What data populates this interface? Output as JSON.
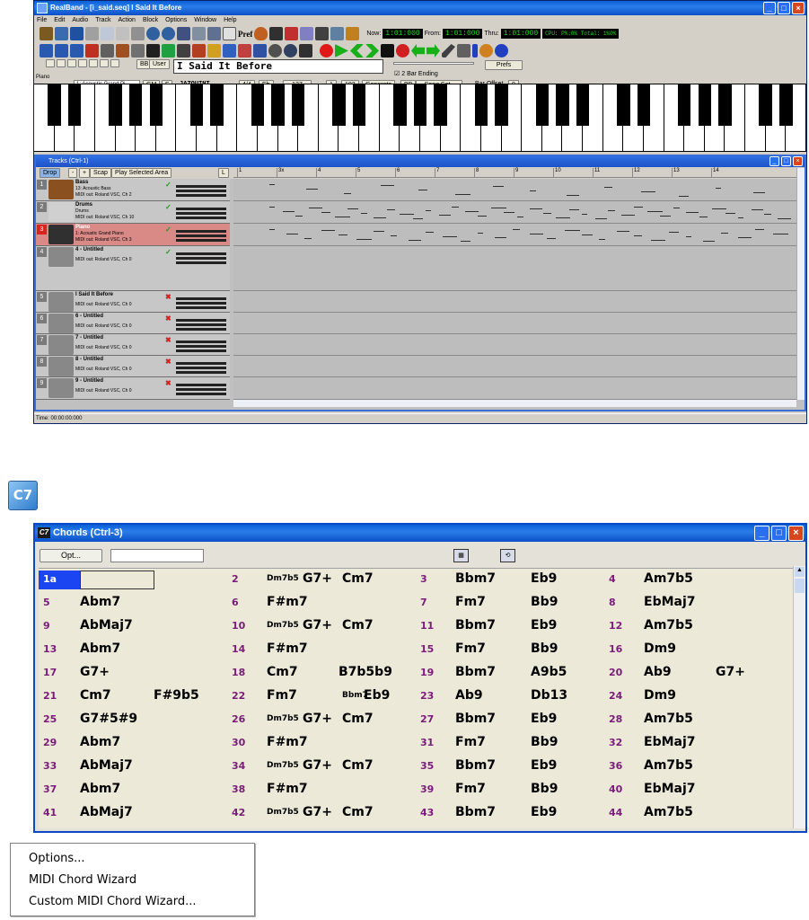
{
  "app": {
    "title": "RealBand - [i_said.seq]   I Said It Before",
    "menu": [
      "File",
      "Edit",
      "Audio",
      "Track",
      "Action",
      "Block",
      "Options",
      "Window",
      "Help"
    ],
    "toolbar_text": {
      "pref": "Pref",
      "now_label": "Now:",
      "now_value": "1:01:000",
      "from_label": "From:",
      "from_value": "1:01:000",
      "thru_label": "Thru:",
      "thru_value": "1:01:000",
      "cpu": "CPU: P%:0% Total: 1%0%"
    },
    "song_title": "I Said It Before",
    "bb_label": "BB",
    "user_label": "User",
    "bar_ending": "2 Bar Ending",
    "prefs_btn": "Prefs",
    "instrument": "1: Acoustic Grand Pi",
    "gm_btn": "GM",
    "f_btn": "F",
    "style": "JAZQUINT",
    "time_sig": "4/4",
    "key": "Eb",
    "tempo": "127",
    "from_bar": "1",
    "to_bar": "103",
    "generate_btn": "Generate",
    "bb_btn": "BB",
    "song_set_btn": "Song Set..",
    "bar_offset_label": "Bar Offset",
    "bar_offset_value": "0",
    "piano_label": "Piano"
  },
  "tracks_window": {
    "title": "Tracks (Ctrl-1)",
    "drop_btn": "Drop",
    "minus_btn": "-",
    "plus_btn": "+",
    "scap_btn": "Scap",
    "play_selected_btn": "Play Selected Area",
    "l_btn": "L",
    "ruler": [
      "1",
      "3x",
      "4",
      "5",
      "6",
      "7",
      "8",
      "9",
      "10",
      "11",
      "12",
      "13",
      "14"
    ],
    "tracks": [
      {
        "num": "1",
        "name": "Bass",
        "sub1": "13: Acoustic Bass",
        "sub2": "MIDI out: Roland VSC, Ch 2",
        "status": "✓",
        "selected": false
      },
      {
        "num": "2",
        "name": "Drums",
        "sub1": "Drums",
        "sub2": "MIDI out: Roland VSC, Ch 10",
        "status": "✓",
        "selected": false
      },
      {
        "num": "3",
        "name": "Piano",
        "sub1": "1: Acoustic Grand Piano",
        "sub2": "MIDI out: Roland VSC, Ch 3",
        "status": "✓",
        "selected": true
      },
      {
        "num": "4",
        "name": "4 - Untitled",
        "sub1": "",
        "sub2": "MIDI out: Roland VSC, Ch 0",
        "status": "✓",
        "selected": false
      },
      {
        "num": "5",
        "name": "I Said It Before",
        "sub1": "",
        "sub2": "MIDI out: Roland VSC, Ch 0",
        "status": "✖",
        "selected": false
      },
      {
        "num": "6",
        "name": "6 - Untitled",
        "sub1": "",
        "sub2": "MIDI out: Roland VSC, Ch 0",
        "status": "✖",
        "selected": false
      },
      {
        "num": "7",
        "name": "7 - Untitled",
        "sub1": "",
        "sub2": "MIDI out: Roland VSC, Ch 0",
        "status": "✖",
        "selected": false
      },
      {
        "num": "8",
        "name": "8 - Untitled",
        "sub1": "",
        "sub2": "MIDI out: Roland VSC, Ch 0",
        "status": "✖",
        "selected": false
      },
      {
        "num": "9",
        "name": "9 - Untitled",
        "sub1": "",
        "sub2": "MIDI out: Roland VSC, Ch 0",
        "status": "✖",
        "selected": false
      }
    ],
    "status_time": "Time: 00:00:00:000"
  },
  "c7_icon_label": "C7",
  "chords_window": {
    "title": "Chords (Ctrl-3)",
    "opt_btn": "Opt...",
    "colors": {
      "bar_number": "#7a1c7a",
      "selected_bar": "#1a45f0",
      "background": "#ece9d8"
    },
    "rows": [
      [
        {
          "n": "1a",
          "c": []
        },
        {
          "n": "2",
          "c": [
            "Dm7b5",
            "G7+",
            "Cm7"
          ]
        },
        {
          "n": "3",
          "c": [
            "Bbm7",
            "Eb9"
          ]
        },
        {
          "n": "4",
          "c": [
            "Am7b5"
          ]
        }
      ],
      [
        {
          "n": "5",
          "c": [
            "Abm7"
          ]
        },
        {
          "n": "6",
          "c": [
            "F#m7"
          ]
        },
        {
          "n": "7",
          "c": [
            "Fm7",
            "Bb9"
          ]
        },
        {
          "n": "8",
          "c": [
            "EbMaj7"
          ]
        }
      ],
      [
        {
          "n": "9",
          "c": [
            "AbMaj7"
          ]
        },
        {
          "n": "10",
          "c": [
            "Dm7b5",
            "G7+",
            "Cm7"
          ]
        },
        {
          "n": "11",
          "c": [
            "Bbm7",
            "Eb9"
          ]
        },
        {
          "n": "12",
          "c": [
            "Am7b5"
          ]
        }
      ],
      [
        {
          "n": "13",
          "c": [
            "Abm7"
          ]
        },
        {
          "n": "14",
          "c": [
            "F#m7"
          ]
        },
        {
          "n": "15",
          "c": [
            "Fm7",
            "Bb9"
          ]
        },
        {
          "n": "16",
          "c": [
            "Dm9"
          ]
        }
      ],
      [
        {
          "n": "17",
          "c": [
            "G7+"
          ]
        },
        {
          "n": "18",
          "c": [
            "Cm7",
            "B7b5b9"
          ]
        },
        {
          "n": "19",
          "c": [
            "Bbm7",
            "A9b5"
          ]
        },
        {
          "n": "20",
          "c": [
            "Ab9",
            "G7+"
          ]
        }
      ],
      [
        {
          "n": "21",
          "c": [
            "Cm7",
            "F#9b5"
          ]
        },
        {
          "n": "22",
          "c": [
            "Fm7",
            "Bbm7",
            "Eb9"
          ]
        },
        {
          "n": "23",
          "c": [
            "Ab9",
            "Db13"
          ]
        },
        {
          "n": "24",
          "c": [
            "Dm9"
          ]
        }
      ],
      [
        {
          "n": "25",
          "c": [
            "G7#5#9"
          ]
        },
        {
          "n": "26",
          "c": [
            "Dm7b5",
            "G7+",
            "Cm7"
          ]
        },
        {
          "n": "27",
          "c": [
            "Bbm7",
            "Eb9"
          ]
        },
        {
          "n": "28",
          "c": [
            "Am7b5"
          ]
        }
      ],
      [
        {
          "n": "29",
          "c": [
            "Abm7"
          ]
        },
        {
          "n": "30",
          "c": [
            "F#m7"
          ]
        },
        {
          "n": "31",
          "c": [
            "Fm7",
            "Bb9"
          ]
        },
        {
          "n": "32",
          "c": [
            "EbMaj7"
          ]
        }
      ],
      [
        {
          "n": "33",
          "c": [
            "AbMaj7"
          ]
        },
        {
          "n": "34",
          "c": [
            "Dm7b5",
            "G7+",
            "Cm7"
          ]
        },
        {
          "n": "35",
          "c": [
            "Bbm7",
            "Eb9"
          ]
        },
        {
          "n": "36",
          "c": [
            "Am7b5"
          ]
        }
      ],
      [
        {
          "n": "37",
          "c": [
            "Abm7"
          ]
        },
        {
          "n": "38",
          "c": [
            "F#m7"
          ]
        },
        {
          "n": "39",
          "c": [
            "Fm7",
            "Bb9"
          ]
        },
        {
          "n": "40",
          "c": [
            "EbMaj7"
          ]
        }
      ],
      [
        {
          "n": "41",
          "c": [
            "AbMaj7"
          ]
        },
        {
          "n": "42",
          "c": [
            "Dm7b5",
            "G7+",
            "Cm7"
          ]
        },
        {
          "n": "43",
          "c": [
            "Bbm7",
            "Eb9"
          ]
        },
        {
          "n": "44",
          "c": [
            "Am7b5"
          ]
        }
      ]
    ]
  },
  "context_menu": {
    "items": [
      "Options...",
      "MIDI Chord Wizard",
      "Custom MIDI Chord Wizard..."
    ]
  }
}
